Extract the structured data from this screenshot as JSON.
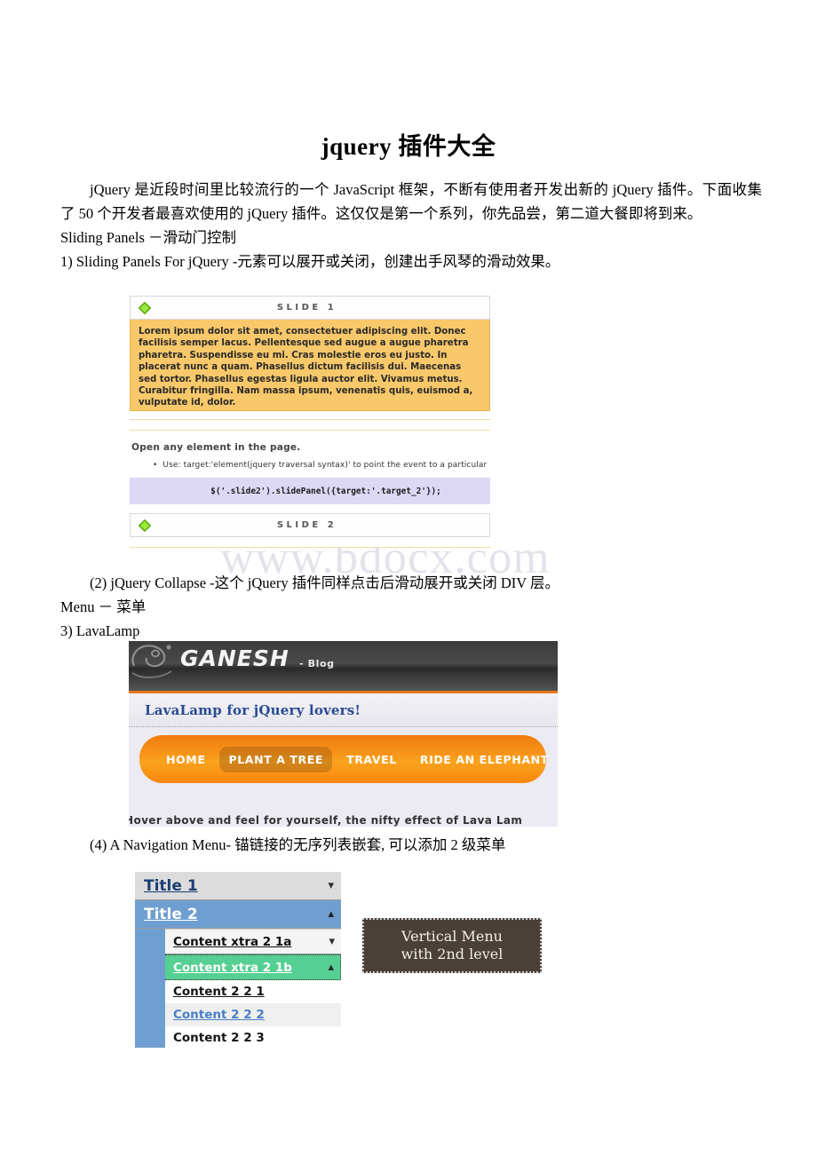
{
  "document": {
    "title": "jquery 插件大全",
    "intro_paragraph": "jQuery 是近段时间里比较流行的一个 JavaScript 框架，不断有使用者开发出新的 jQuery 插件。下面收集了 50 个开发者最喜欢使用的 jQuery 插件。这仅仅是第一个系列，你先品尝，第二道大餐即将到来。",
    "section_sliding": "Sliding Panels －滑动门控制",
    "item_1": "1) Sliding Panels For jQuery -元素可以展开或关闭，创建出手风琴的滑动效果。",
    "item_2": "(2) jQuery Collapse -这个 jQuery 插件同样点击后滑动展开或关闭 DIV 层。",
    "section_menu": "Menu － 菜单",
    "item_3": "3) LavaLamp",
    "item_4": "(4) A Navigation Menu- 锚链接的无序列表嵌套, 可以添加 2 级菜单",
    "watermark": "www.bdocx.com"
  },
  "figure_sliding_panels": {
    "slide1_title": "SLIDE 1",
    "slide1_body": "Lorem ipsum dolor sit amet, consectetuer adipiscing elit. Donec facilisis semper lacus. Pellentesque sed augue a augue pharetra pharetra. Suspendisse eu mi. Cras molestie eros eu justo. In placerat nunc a quam. Phasellus dictum facilisis dui. Maecenas sed tortor. Phasellus egestas ligula auctor elit. Vivamus metus. Curabitur fringilla. Nam massa ipsum, venenatis quis, euismod a, vulputate id, dolor.",
    "open_heading": "Open any element in the page.",
    "bullet_text": "Use: target:'element(jquery traversal syntax)' to point the event to a particular",
    "code_snippet": "$('.slide2').slidePanel({target:'.target_2'});",
    "slide2_title": "SLIDE 2",
    "arrow_icon": "green-diamond-arrow-icon",
    "colors": {
      "panel_bg": "#f8c86a",
      "code_bg": "#dcd8f5",
      "arrow": "#7ed321"
    }
  },
  "figure_lavalamp": {
    "logo_text": "GANESH",
    "blog_label": "- Blog",
    "subtitle": "LavaLamp for jQuery lovers!",
    "nav_items": [
      {
        "label": "HOME",
        "active": false
      },
      {
        "label": "PLANT A TREE",
        "active": true
      },
      {
        "label": "TRAVEL",
        "active": false
      },
      {
        "label": "RIDE AN ELEPHANT",
        "active": false
      }
    ],
    "hover_text": "Hover above and feel for yourself, the nifty effect of Lava Lam",
    "colors": {
      "nav_orange": "#f79418",
      "banner_dark": "#3b3b3b",
      "accent_rule": "#e8761b",
      "subtitle_blue": "#2a4b92"
    }
  },
  "figure_nav_menu": {
    "rows": [
      {
        "label": "Title 1",
        "level": 1,
        "state": "collapsed",
        "chevron": "chevron-down-icon"
      },
      {
        "label": "Title 2",
        "level": 1,
        "state": "expanded",
        "chevron": "chevron-up-icon"
      },
      {
        "label": "Content xtra 2 1a",
        "level": 2,
        "state": "collapsed",
        "chevron": "chevron-down-icon"
      },
      {
        "label": "Content xtra 2 1b",
        "level": 2,
        "state": "expanded",
        "chevron": "chevron-up-icon"
      },
      {
        "label": "Content 2 2 1",
        "level": 3,
        "state": "",
        "chevron": ""
      },
      {
        "label": "Content 2 2 2",
        "level": 3,
        "state": "",
        "chevron": ""
      },
      {
        "label": "Content 2 2 3",
        "level": 3,
        "state": "",
        "chevron": ""
      }
    ],
    "colors": {
      "title1_bg": "#dcdcdc",
      "title2_bg": "#6f9fd0",
      "selected_bg": "#55cf92",
      "link_blue": "#4a7fc4"
    }
  },
  "figure_label_box": {
    "line1": "Vertical Menu",
    "line2": "with 2nd level",
    "bg_color": "#4a4038"
  }
}
